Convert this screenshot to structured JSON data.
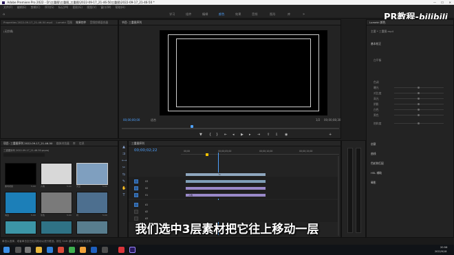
{
  "window": {
    "title": "Adobe Premiere Pro 2022 - D:\\三重图\\三重图_三重图\\2022-09-17_21-46-50三重图\\2022-09-17_21-46-50 *"
  },
  "menu": [
    "文件(F)",
    "编辑(E)",
    "剪辑(C)",
    "序列(S)",
    "标记(M)",
    "图形(G)",
    "视图(V)",
    "窗口(W)",
    "帮助(H)"
  ],
  "workspace_tabs": [
    "学习",
    "组件",
    "编辑",
    "颜色",
    "效果",
    "音频",
    "图形",
    "库"
  ],
  "workspace_active_index": 3,
  "source_panel": {
    "tabs": [
      "Properties 2022-09-17_21-46-50.mp4",
      "Lumetri 范围",
      "效果控件",
      "音频剪辑混合器"
    ],
    "empty_msg": "(无剪辑)"
  },
  "program_panel": {
    "tab": "节目: 三重图序列",
    "timecode_left": "00;00;00;00",
    "fit_label": "适合",
    "fraction": "1/2",
    "timecode_right": "00;00;08;30"
  },
  "effects_panel": {
    "title": "Lumetri 颜色",
    "clip_label": "主要 * 三重图.mp4",
    "section_basic": "基本校正",
    "rows": [
      "白平衡",
      "色调",
      "曝光",
      "对比度",
      "高光",
      "阴影",
      "白色",
      "黑色",
      "饱和度"
    ],
    "sections": [
      "创意",
      "曲线",
      "色轮和匹配",
      "HSL 辅助",
      "晕影"
    ]
  },
  "project_panel": {
    "tabs": [
      "项目: 三重图序列 2022-09-17_21-46-50",
      "媒体浏览器",
      "库",
      "信息"
    ],
    "path": "三重图序列 2022-09-17_21-46-50.prproj",
    "items": [
      {
        "name": "黑场视频",
        "dur": "5;00",
        "color": "#000000"
      },
      {
        "name": "人物",
        "dur": "5;00",
        "color": "#d8d8d8"
      },
      {
        "name": "天空",
        "dur": "5;00",
        "color": "#7f9fbf"
      },
      {
        "name": "海边",
        "dur": "5;00",
        "color": "#1c7fb8"
      },
      {
        "name": "灰色",
        "dur": "5;00",
        "color": "#7a7a7a"
      },
      {
        "name": "树",
        "dur": "5;00",
        "color": "#4d6f8f"
      },
      {
        "name": "浪花",
        "dur": "5;00",
        "color": "#3c95a6"
      },
      {
        "name": "海浪",
        "dur": "5;00",
        "color": "#2f7285"
      },
      {
        "name": "礁石",
        "dur": "5;00",
        "color": "#587d8e"
      }
    ]
  },
  "timeline": {
    "tab": "三重图序列",
    "timecode": "00;00;02;22",
    "ruler": [
      "00;00",
      "00;00;05;00",
      "00;00;10;00",
      "00;00;15;00"
    ],
    "video_tracks": [
      "V3",
      "V2",
      "V1"
    ],
    "audio_tracks": [
      "A1",
      "A2",
      "A3"
    ],
    "clip_label_v1": "人物",
    "clip_label_v3": "fx"
  },
  "status": {
    "text": "单击以选择，或者单击空白处并拖动以进行框选。按住 Shift 键并单击添加到选择。"
  },
  "subtitle": "我们选中3层素材把它往上移动一层",
  "logo": {
    "text": "PR教程-",
    "brand": "bilibili"
  },
  "taskbar": {
    "time": "20:56",
    "date": "2022/9/18"
  },
  "colors": {
    "accent": "#4fa2ff",
    "clip_v1": "#9a89c9",
    "clip_v2": "#7f9fb7",
    "clip_v3": "#8fa7bf"
  }
}
